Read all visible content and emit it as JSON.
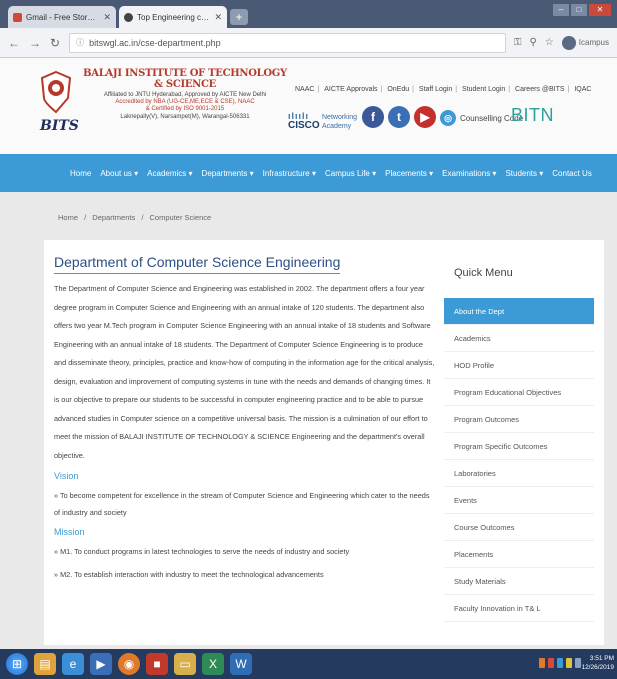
{
  "browser": {
    "tabs": [
      {
        "title": "Gmail - Free Storage and Email",
        "favicon_color": "#d44638"
      },
      {
        "title": "Top Engineering college for CSE",
        "favicon_color": "#444444"
      }
    ],
    "new_tab": "+",
    "url": "bitswgl.ac.in/cse-department.php",
    "profile": "Icampus"
  },
  "header": {
    "logo": "BITS",
    "inst_name": "BALAJI INSTITUTE OF TECHNOLOGY & SCIENCE",
    "line1": "Affiliated to JNTU Hyderabad, Approved by AICTE New Delhi",
    "line2": "Accredited by NBA (UG-CE,ME,ECE & CSE), NAAC",
    "line3": "& Certified by ISO 9001-2015",
    "line4": "Laknepally(V), Narsampet(M), Warangal-506331",
    "top_links": [
      "NAAC",
      "AICTE Approvals",
      "OnEdu",
      "Staff Login",
      "Student Login",
      "Careers @BITS",
      "IQAC"
    ],
    "cisco_word": "CISCO",
    "cisco_na": "Networking Academy",
    "counselling_label": "Counselling Code",
    "counselling_code": "BITN"
  },
  "nav": [
    "Home",
    "About us ▾",
    "Academics ▾",
    "Departments ▾",
    "Infrastructure ▾",
    "Campus Life ▾",
    "Placements ▾",
    "Examinations ▾",
    "Students ▾",
    "Contact Us"
  ],
  "breadcrumb": [
    "Home",
    "/",
    "Departments",
    "/",
    "Computer Science"
  ],
  "content": {
    "title": "Department of Computer Science Engineering",
    "paragraph": "The Department of Computer Science and Engineering was established in 2002. The department offers a four year degree program in Computer Science and Engineering with an annual intake of 120 students. The department also offers two year M.Tech program in Computer Science Engineering with an annual intake of 18 students and Software Engineering with an annual intake of 18 students. The Department of Computer Science Engineering is to produce and disseminate theory, principles, practice and know-how of computing in the information age for the critical analysis, design, evaluation and improvement of computing systems in tune with the needs and demands of changing times. It is our objective to prepare our students to be successful in computer engineering practice and to be able to pursue advanced studies in Computer science on a competitive universal basis. The mission is a culmination of our effort to meet the mission of BALAJI INSTITUTE OF TECHNOLOGY & SCIENCE Engineering and the department's overall objective.",
    "vision_heading": "Vision",
    "vision": "» To become competent for excellence in the stream of Computer Science and Engineering which cater to the needs of industry and society",
    "mission_heading": "Mission",
    "mission": [
      "» M1. To conduct programs in latest technologies to serve the needs of industry and society",
      "» M2. To establish interaction with industry to meet the technological advancements"
    ]
  },
  "quick_menu": {
    "title": "Quick Menu",
    "items": [
      "About the Dept",
      "Academics",
      "HOD Profile",
      "Program Educational Objectives",
      "Program Outcomes",
      "Program Specific Outcomes",
      "Laboratories",
      "Events",
      "Course Outcomes",
      "Placements",
      "Study Materials",
      "Faculty Innovation in T& L"
    ]
  },
  "taskbar": {
    "time": "3:51 PM",
    "date": "12/26/2019"
  }
}
